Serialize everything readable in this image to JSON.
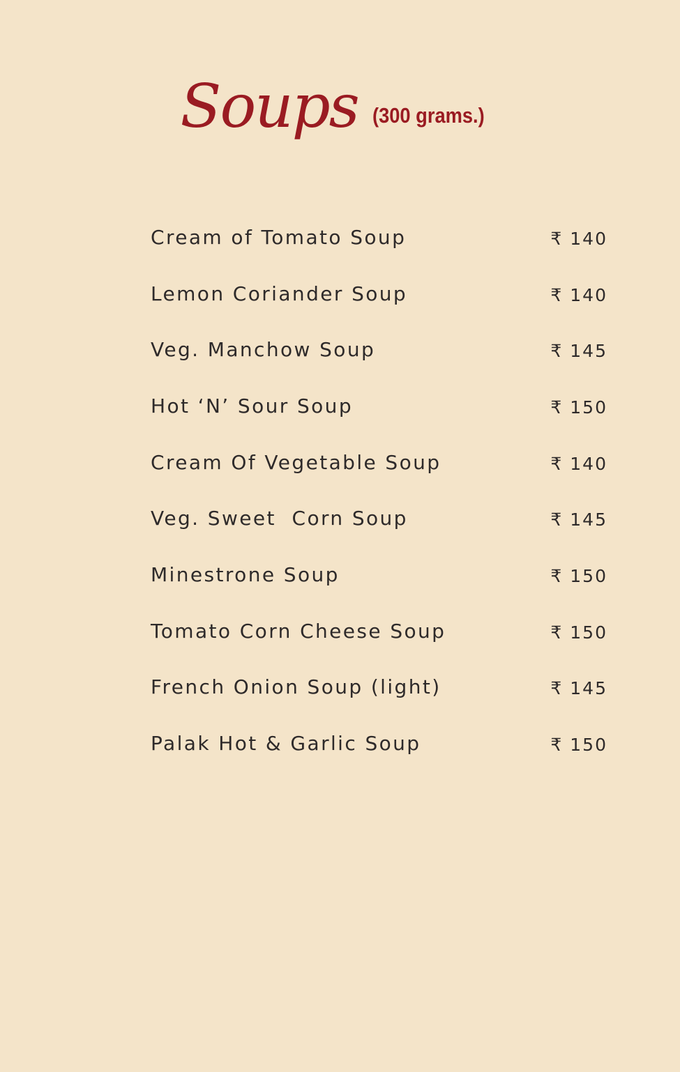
{
  "header": {
    "title": "Soups",
    "subtitle": "(300 grams.)"
  },
  "items": [
    {
      "name": "Cream of Tomato Soup",
      "price": "₹ 140"
    },
    {
      "name": "Lemon Coriander Soup",
      "price": "₹ 140"
    },
    {
      "name": "Veg. Manchow Soup",
      "price": "₹ 145"
    },
    {
      "name": "Hot ‘N’ Sour Soup",
      "price": "₹ 150"
    },
    {
      "name": "Cream Of Vegetable Soup",
      "price": "₹ 140"
    },
    {
      "name": "Veg. Sweet  Corn Soup",
      "price": "₹ 145"
    },
    {
      "name": "Minestrone Soup",
      "price": "₹ 150"
    },
    {
      "name": "Tomato Corn Cheese Soup",
      "price": "₹ 150"
    },
    {
      "name": "French Onion Soup (light)",
      "price": "₹ 145"
    },
    {
      "name": "Palak Hot & Garlic Soup",
      "price": "₹ 150"
    }
  ]
}
